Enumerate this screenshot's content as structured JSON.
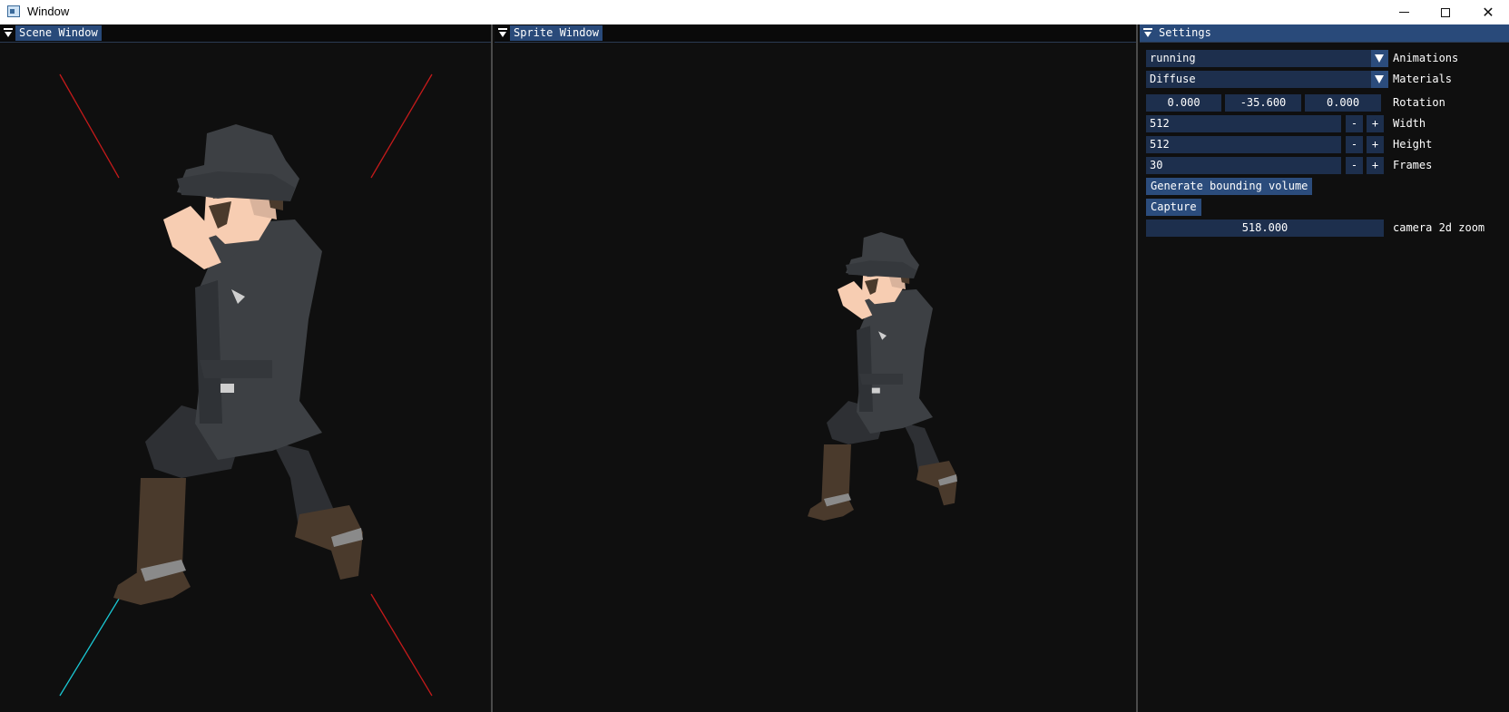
{
  "window": {
    "title": "Window"
  },
  "panels": {
    "scene": {
      "title": "Scene Window"
    },
    "sprite": {
      "title": "Sprite Window"
    },
    "settings": {
      "title": "Settings"
    }
  },
  "settings": {
    "animations": {
      "value": "running",
      "label": "Animations"
    },
    "materials": {
      "value": "Diffuse",
      "label": "Materials"
    },
    "rotation": {
      "x": "0.000",
      "y": "-35.600",
      "z": "0.000",
      "label": "Rotation"
    },
    "width": {
      "value": "512",
      "label": "Width",
      "minus": "-",
      "plus": "+"
    },
    "height": {
      "value": "512",
      "label": "Height",
      "minus": "-",
      "plus": "+"
    },
    "frames": {
      "value": "30",
      "label": "Frames",
      "minus": "-",
      "plus": "+"
    },
    "generate_button": "Generate bounding volume",
    "capture_button": "Capture",
    "zoom": {
      "value": "518.000",
      "label": "camera 2d zoom"
    }
  },
  "colors": {
    "panel_bg": "#0f0f0f",
    "frame_bg": "#1d2f4d",
    "button_bg": "#2b4c7c",
    "active_title": "#294a7a",
    "bounds_line": "#c41a1a",
    "axis_line": "#1ac8d4",
    "coat": "#3d4044",
    "skin": "#f7cdb2",
    "boot": "#4a3a2c"
  }
}
